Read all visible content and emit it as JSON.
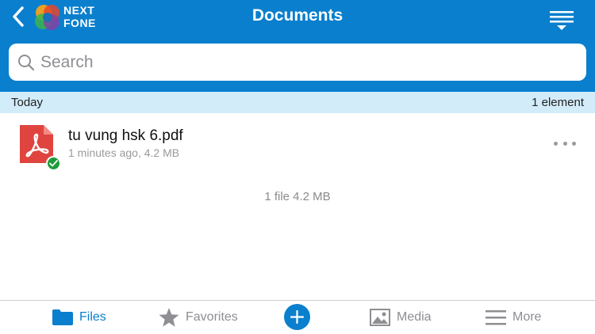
{
  "header": {
    "title": "Documents",
    "brand_line1": "NEXT",
    "brand_line2": "FONE",
    "back_icon": "chevron-left-icon",
    "sort_icon": "sort-menu-icon",
    "accent_color": "#0a7fcd"
  },
  "search": {
    "placeholder": "Search",
    "value": ""
  },
  "section": {
    "label": "Today",
    "count": "1 element",
    "background": "#d3ecfa"
  },
  "files": [
    {
      "name": "tu vung hsk 6.pdf",
      "meta": "1 minutes ago, 4.2 MB",
      "type_icon": "pdf-icon",
      "status_icon": "synced-check-icon"
    }
  ],
  "summary": "1 file 4.2 MB",
  "tabbar": {
    "files": "Files",
    "favorites": "Favorites",
    "media": "Media",
    "more": "More",
    "add_icon": "plus-icon"
  }
}
